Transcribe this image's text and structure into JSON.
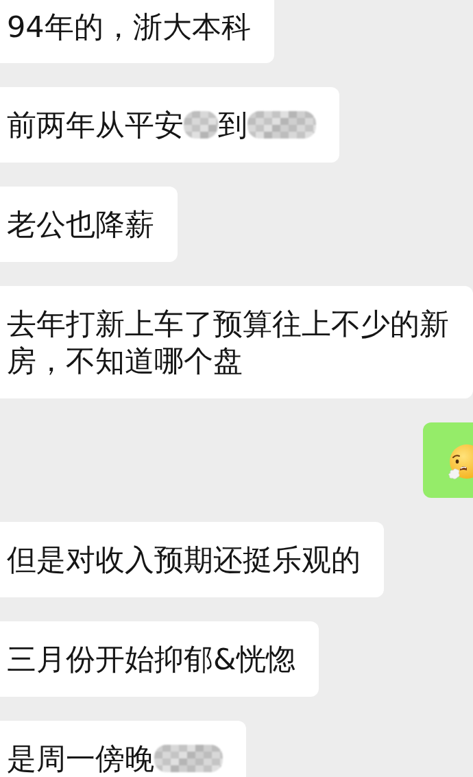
{
  "messages": [
    {
      "outgoing": false,
      "kind": "text",
      "parts": [
        {
          "kind": "text",
          "text": "94年的，浙大本科"
        }
      ]
    },
    {
      "outgoing": false,
      "kind": "text",
      "parts": [
        {
          "kind": "text",
          "text": "前两年从平安"
        },
        {
          "kind": "redacted",
          "wide": false
        },
        {
          "kind": "text",
          "text": "到"
        },
        {
          "kind": "redacted",
          "wide": true
        }
      ]
    },
    {
      "outgoing": false,
      "kind": "text",
      "parts": [
        {
          "kind": "text",
          "text": "老公也降薪"
        }
      ]
    },
    {
      "outgoing": false,
      "kind": "text",
      "parts": [
        {
          "kind": "text",
          "text": "去年打新上车了预算往上不少的新房，不知道哪个盘"
        }
      ]
    },
    {
      "outgoing": true,
      "kind": "emoji"
    },
    {
      "outgoing": false,
      "kind": "text",
      "parts": [
        {
          "kind": "text",
          "text": "但是对收入预期还挺乐观的"
        }
      ]
    },
    {
      "outgoing": false,
      "kind": "text",
      "parts": [
        {
          "kind": "text",
          "text": "三月份开始抑郁&恍惚"
        }
      ]
    },
    {
      "outgoing": false,
      "kind": "text",
      "parts": [
        {
          "kind": "text",
          "text": "是周一傍晚"
        },
        {
          "kind": "redacted",
          "wide": true
        }
      ]
    }
  ]
}
